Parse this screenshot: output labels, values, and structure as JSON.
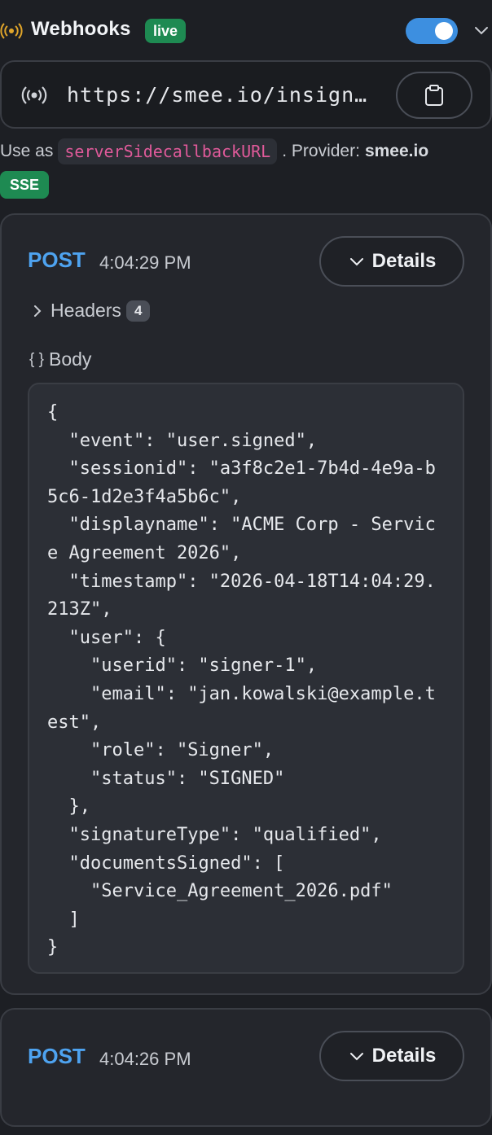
{
  "header": {
    "title": "Webhooks",
    "status_badge": "live"
  },
  "url_bar": {
    "url": "https://smee.io/insign…"
  },
  "use_line": {
    "prefix": "Use as",
    "code": "serverSidecallbackURL",
    "provider_label": ". Provider:",
    "provider_name": "smee.io"
  },
  "transport_badge": "SSE",
  "events": [
    {
      "method": "POST",
      "time": "4:04:29 PM",
      "details_label": "Details",
      "headers_label": "Headers",
      "headers_count": "4",
      "body_label": "Body",
      "body": "{\n  \"event\": \"user.signed\",\n  \"sessionid\": \"a3f8c2e1-7b4d-4e9a-b5c6-1d2e3f4a5b6c\",\n  \"displayname\": \"ACME Corp - Service Agreement 2026\",\n  \"timestamp\": \"2026-04-18T14:04:29.213Z\",\n  \"user\": {\n    \"userid\": \"signer-1\",\n    \"email\": \"jan.kowalski@example.test\",\n    \"role\": \"Signer\",\n    \"status\": \"SIGNED\"\n  },\n  \"signatureType\": \"qualified\",\n  \"documentsSigned\": [\n    \"Service_Agreement_2026.pdf\"\n  ]\n}"
    },
    {
      "method": "POST",
      "time": "4:04:26 PM",
      "details_label": "Details"
    }
  ],
  "colors": {
    "accent_blue": "#4ea3f0",
    "live_green": "#1e8a52",
    "toggle_blue": "#3d8fe0",
    "code_pink": "#e05a9a",
    "radio_orange": "#e0a52a"
  },
  "icons": {
    "header": "radio-broadcast-icon",
    "url": "radio-broadcast-icon",
    "copy": "clipboard-icon",
    "chevron": "chevron-down-icon",
    "headers": "chevron-right-icon",
    "body": "braces-icon"
  }
}
